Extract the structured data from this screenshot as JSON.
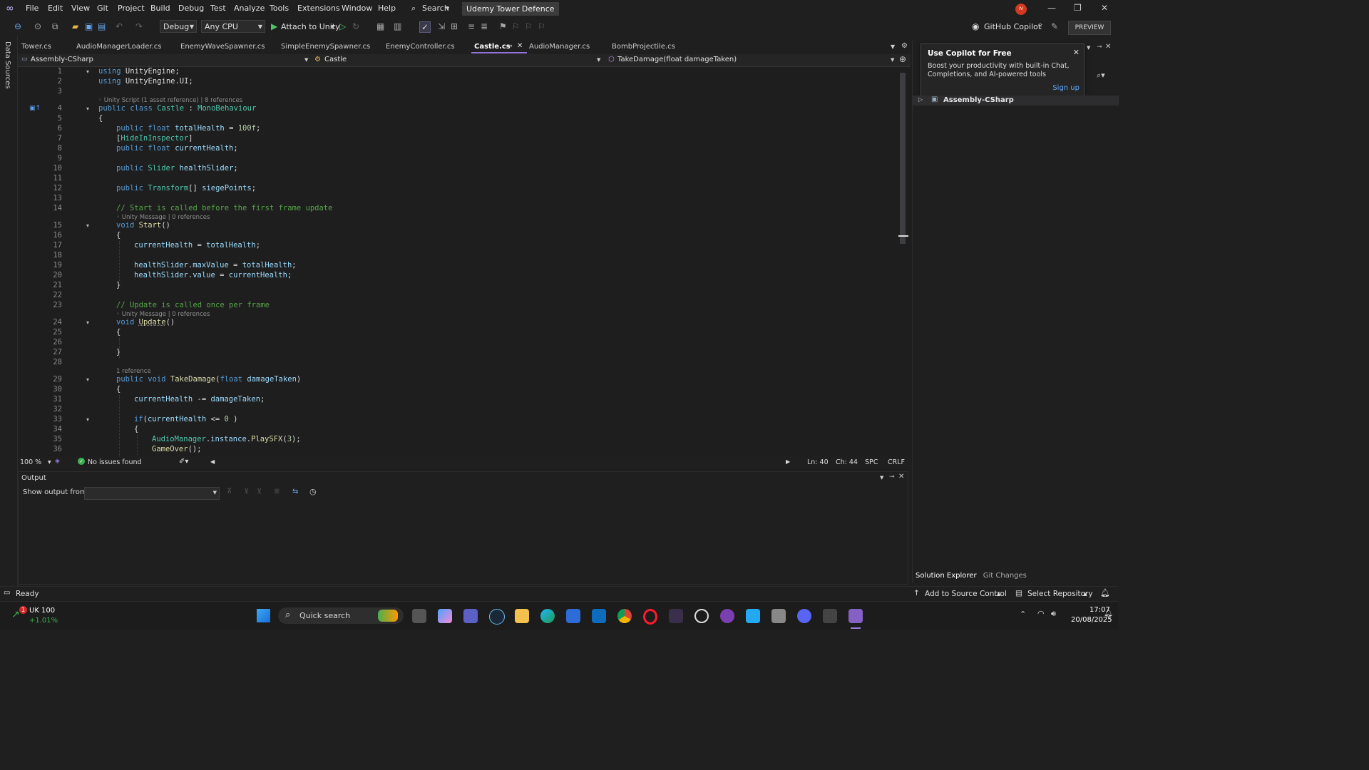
{
  "menu": {
    "items": [
      "File",
      "Edit",
      "View",
      "Git",
      "Project",
      "Build",
      "Debug",
      "Test",
      "Analyze",
      "Tools",
      "Extensions",
      "Window",
      "Help"
    ],
    "search_label": "Search",
    "project_title": "Udemy Tower Defence",
    "avatar_initials": "IV"
  },
  "toolbar": {
    "config": "Debug",
    "platform": "Any CPU",
    "attach_label": "Attach to Unity",
    "copilot_label": "GitHub Copilot",
    "preview_label": "PREVIEW"
  },
  "leftrail": {
    "data_sources": "Data Sources"
  },
  "tabs": [
    {
      "label": "Tower.cs"
    },
    {
      "label": "AudioManagerLoader.cs"
    },
    {
      "label": "EnemyWaveSpawner.cs"
    },
    {
      "label": "SimpleEnemySpawner.cs"
    },
    {
      "label": "EnemyController.cs"
    },
    {
      "label": "Castle.cs"
    },
    {
      "label": "AudioManager.cs"
    },
    {
      "label": "BombProjectile.cs"
    }
  ],
  "navbar": {
    "project": "Assembly-CSharp",
    "type": "Castle",
    "member": "TakeDamage(float damageTaken)"
  },
  "lens": {
    "l4": "Unity Script (1 asset reference) | 8 references",
    "l15": "Unity Message | 0 references",
    "l24": "Unity Message | 0 references",
    "l29": "1 reference"
  },
  "line_numbers": [
    "1",
    "2",
    "3",
    "4",
    "5",
    "6",
    "7",
    "8",
    "9",
    "10",
    "11",
    "12",
    "13",
    "14",
    "15",
    "16",
    "17",
    "18",
    "19",
    "20",
    "21",
    "22",
    "23",
    "24",
    "25",
    "26",
    "27",
    "28",
    "29",
    "30",
    "31",
    "32",
    "33",
    "34",
    "35",
    "36"
  ],
  "editor_status": {
    "zoom": "100 %",
    "issues": "No issues found",
    "ln": "Ln: 40",
    "ch": "Ch: 44",
    "spc": "SPC",
    "crlf": "CRLF"
  },
  "output": {
    "title": "Output",
    "show_from": "Show output from:"
  },
  "solution": {
    "popup_title": "Use Copilot for Free",
    "popup_body": "Boost your productivity with built-in Chat, Completions, and AI-powered tools",
    "popup_signup": "Sign up",
    "tree_item": "Assembly-CSharp",
    "tab_solution": "Solution Explorer",
    "tab_git": "Git Changes"
  },
  "statusbar": {
    "ready": "Ready",
    "source_control": "Add to Source Control",
    "repository": "Select Repository"
  },
  "taskbar": {
    "stock_name": "UK 100",
    "stock_change": "+1.01%",
    "stock_badge": "1",
    "search_label": "Quick search",
    "time": "17:07",
    "date": "20/08/2025"
  }
}
